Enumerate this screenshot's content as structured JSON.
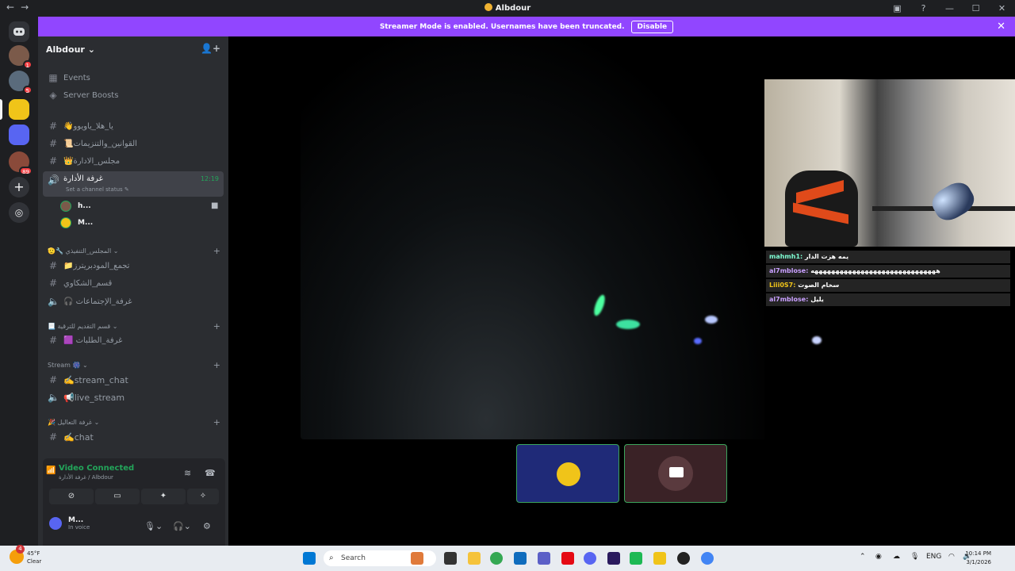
{
  "window": {
    "title": "Albdour",
    "nav_back": "←",
    "nav_fwd": "→"
  },
  "banner": {
    "text": "Streamer Mode is enabled. Usernames have been truncated.",
    "button": "Disable",
    "close": "✕"
  },
  "rail": {
    "badges": [
      "1",
      "5",
      "89"
    ]
  },
  "server": {
    "name": "Albdour",
    "chevron": "⌄",
    "add_member": "👤+"
  },
  "sidebar": {
    "events": "Events",
    "boosts": "Server Boosts",
    "channels": [
      {
        "label": "👋يا_هلا_ياويوو"
      },
      {
        "label": "📜القوانين_والتنزيمات"
      },
      {
        "label": "👑مجلس_الادارة"
      }
    ],
    "active_voice": {
      "label": "غرفة الأدارة",
      "time": "12:19",
      "status": "Set a channel status ✎"
    },
    "voice_users": [
      "h...",
      "M..."
    ],
    "categories": [
      {
        "label": "🫡🔧 المجلس_التنفيذي ⌄"
      },
      {
        "label": "📃 قسم التقديم للترقية ⌄"
      },
      {
        "label": "Stream 🎆 ⌄"
      },
      {
        "label": "🎉 غرفة التعاليل ⌄"
      }
    ],
    "exec_channels": [
      "📁تجمع_المودبريترز",
      "قسم_الشكاوي",
      "🎧 غرفة_الإجتماعات"
    ],
    "promo_channels": [
      "🟪 غرفة_الطلبات"
    ],
    "stream_channels": [
      "✍️stream_chat",
      "📢live_stream"
    ],
    "chill_channels": [
      "✍️chat"
    ]
  },
  "voice_panel": {
    "status": "Video Connected",
    "location": "غرفة الأدارة / Albdour",
    "user": "M...",
    "user_status": "In voice"
  },
  "chat_overlay": [
    {
      "user": "mahmh1:",
      "msg": "يمه هزت الدار"
    },
    {
      "user": "al7mblose:",
      "msg": "ههههههههههههههههههههههههههههههه"
    },
    {
      "user": "Liii0S7:",
      "msg": "سخام الصوت"
    },
    {
      "user": "al7mblose:",
      "msg": "يليل"
    }
  ],
  "taskbar": {
    "temp": "45°F",
    "condition": "Clear",
    "weather_badge": "4",
    "search": "Search",
    "lang": "ENG",
    "time": "10:14 PM",
    "date": "3/1/2026"
  },
  "colors": {
    "accent": "#9146ff",
    "online": "#23a55a",
    "sidebar": "#2b2d31",
    "rail": "#1e1f22"
  }
}
